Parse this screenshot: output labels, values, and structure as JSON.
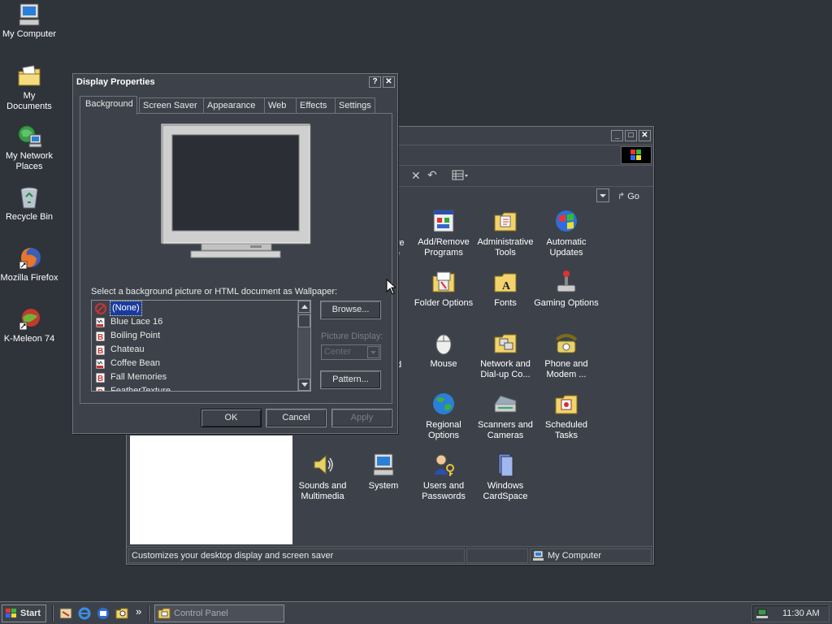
{
  "desktop": {
    "icons": [
      {
        "label": "My Computer"
      },
      {
        "label": "My Documents"
      },
      {
        "label": "My Network Places"
      },
      {
        "label": "Recycle Bin"
      },
      {
        "label": "Mozilla Firefox"
      },
      {
        "label": "K-Meleon 74"
      }
    ]
  },
  "display_props": {
    "title": "Display Properties",
    "help_btn": "?",
    "close_btn": "✕",
    "tabs": [
      "Background",
      "Screen Saver",
      "Appearance",
      "Web",
      "Effects",
      "Settings"
    ],
    "wallpaper_label": "Select a background picture or HTML document as Wallpaper:",
    "wallpapers": [
      "(None)",
      "Blue Lace 16",
      "Boiling Point",
      "Chateau",
      "Coffee Bean",
      "Fall Memories",
      "FeatherTexture"
    ],
    "browse_label": "Browse...",
    "picture_display_label": "Picture Display:",
    "picture_display_value": "Center",
    "pattern_label": "Pattern...",
    "ok_label": "OK",
    "cancel_label": "Cancel",
    "apply_label": "Apply"
  },
  "control_panel": {
    "go_label": "Go",
    "status_text": "Customizes your desktop display and screen saver",
    "status_location": "My Computer",
    "partial_labels": [
      "ve",
      "e",
      "d"
    ],
    "items": [
      {
        "label": "Add/Remove Programs"
      },
      {
        "label": "Administrative Tools"
      },
      {
        "label": "Automatic Updates"
      },
      {
        "label": "Folder Options"
      },
      {
        "label": "Fonts"
      },
      {
        "label": "Gaming Options"
      },
      {
        "label": "Mouse"
      },
      {
        "label": "Network and Dial-up Co..."
      },
      {
        "label": "Phone and Modem ..."
      },
      {
        "label": "Regional Options"
      },
      {
        "label": "Scanners and Cameras"
      },
      {
        "label": "Scheduled Tasks"
      },
      {
        "label": "Sounds and Multimedia"
      },
      {
        "label": "System"
      },
      {
        "label": "Users and Passwords"
      },
      {
        "label": "Windows CardSpace"
      }
    ]
  },
  "taskbar": {
    "start_label": "Start",
    "chevron": "»",
    "task_label": "Control Panel",
    "clock": "11:30 AM"
  }
}
